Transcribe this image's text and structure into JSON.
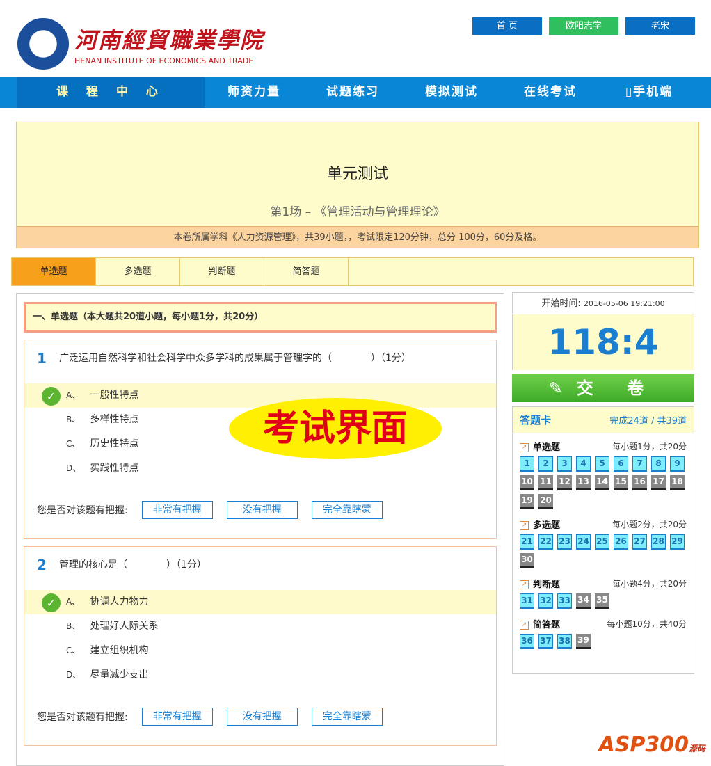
{
  "header": {
    "logo_cn": "河南經貿職業學院",
    "logo_en": "HENAN INSTITUTE OF ECONOMICS AND TRADE",
    "links": [
      "首 页",
      "欧阳志学",
      "老宋"
    ]
  },
  "nav": [
    "课 程 中 心",
    "师资力量",
    "试题练习",
    "模拟测试",
    "在线考试",
    "手机端"
  ],
  "banner": {
    "title": "单元测试",
    "subtitle": "第1场 – 《管理活动与管理理论》",
    "info": "本卷所属学科《人力资源管理》，共39小题，，考试限定120分钟，总分 100分，60分及格。"
  },
  "tabs": [
    "单选题",
    "多选题",
    "判断题",
    "简答题"
  ],
  "section_title": "一、单选题（本大题共20道小题，每小题1分，共20分）",
  "confidence": {
    "label": "您是否对该题有把握:",
    "options": [
      "非常有把握",
      "没有把握",
      "完全靠瞎蒙"
    ]
  },
  "questions": [
    {
      "num": "1",
      "text": "广泛运用自然科学和社会科学中众多学科的成果属于管理学的（　　　　）（1分）",
      "options": [
        {
          "letter": "A、",
          "text": "一般性特点",
          "selected": true
        },
        {
          "letter": "B、",
          "text": "多样性特点"
        },
        {
          "letter": "C、",
          "text": "历史性特点"
        },
        {
          "letter": "D、",
          "text": "实践性特点"
        }
      ]
    },
    {
      "num": "2",
      "text": "管理的核心是（　　　　）（1分）",
      "options": [
        {
          "letter": "A、",
          "text": "协调人力物力",
          "selected": true
        },
        {
          "letter": "B、",
          "text": "处理好人际关系"
        },
        {
          "letter": "C、",
          "text": "建立组织机构"
        },
        {
          "letter": "D、",
          "text": "尽量减少支出"
        }
      ]
    }
  ],
  "watermark": "考试界面",
  "timer": {
    "label": "开始时间:",
    "start": "2016-05-06 19:21:00",
    "remaining": "118:4"
  },
  "submit": "交 卷",
  "card": {
    "title": "答题卡",
    "progress": "完成24道 / 共39道",
    "groups": [
      {
        "name": "单选题",
        "score": "每小题1分，共20分",
        "items": [
          "1",
          "2",
          "3",
          "4",
          "5",
          "6",
          "7",
          "8",
          "9",
          "10",
          "11",
          "12",
          "13",
          "14",
          "15",
          "16",
          "17",
          "18",
          "19",
          "20"
        ],
        "done": 9
      },
      {
        "name": "多选题",
        "score": "每小题2分，共20分",
        "items": [
          "21",
          "22",
          "23",
          "24",
          "25",
          "26",
          "27",
          "28",
          "29",
          "30"
        ],
        "done": 9
      },
      {
        "name": "判断题",
        "score": "每小题4分，共20分",
        "items": [
          "31",
          "32",
          "33",
          "34",
          "35"
        ],
        "done": 3
      },
      {
        "name": "简答题",
        "score": "每小题10分，共40分",
        "items": [
          "36",
          "37",
          "38",
          "39"
        ],
        "done": 3
      }
    ]
  },
  "site_mark": {
    "brand": "ASP300",
    "suffix": "源码"
  }
}
